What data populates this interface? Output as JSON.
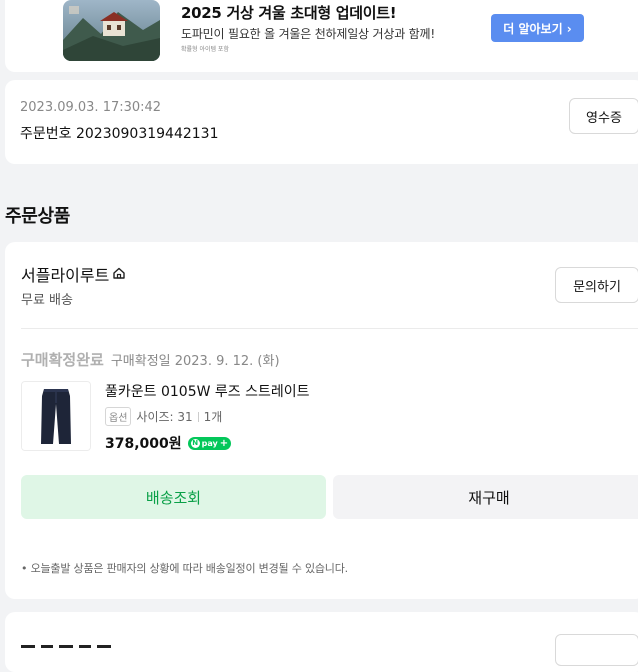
{
  "ad": {
    "title": "2025 거상 겨울 초대형 업데이트!",
    "subtitle": "도파민이 필요한 올 겨울은 천하제일상 거상과 함께!",
    "note": "확률형 아이템 포함",
    "button_label": "더 알아보기 ›",
    "button_color": "#5a8df0"
  },
  "order": {
    "datetime": "2023.09.03. 17:30:42",
    "order_number_text": "주문번호 2023090319442131",
    "receipt_label": "영수증"
  },
  "section_title": "주문상품",
  "product_card": {
    "seller_name": "서플라이루트",
    "seller_icon": "home-icon",
    "shipping": "무료 배송",
    "inquiry_label": "문의하기",
    "status_label": "구매확정완료",
    "status_date": "구매확정일 2023. 9. 12. (화)",
    "product": {
      "name": "풀카운트 0105W 루즈 스트레이트",
      "option_tag": "옵션",
      "option_value": "사이즈: 31",
      "quantity": "1개",
      "price": "378,000원",
      "pay_badge": "pay",
      "pay_badge_color": "#03c75a",
      "thumbnail": "jeans-thumbnail"
    },
    "track_label": "배송조회",
    "track_color": "#0aa048",
    "rebuy_label": "재구매",
    "notice": "• 오늘출발 상품은 판매자의 상황에 따라 배송일정이 변경될 수 있습니다."
  }
}
